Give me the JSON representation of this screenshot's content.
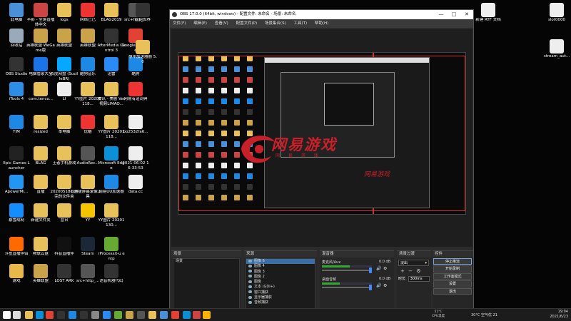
{
  "desktop_icons": [
    {
      "label": "此电脑",
      "color": "#4a90d9"
    },
    {
      "label": "回收站",
      "color": "#9ab"
    },
    {
      "label": "OBS Studio",
      "color": "#333"
    },
    {
      "label": "iTools 4",
      "color": "#2c8ee6"
    },
    {
      "label": "TIM",
      "color": "#1e88e5"
    },
    {
      "label": "Epic Games Launcher",
      "color": "#222"
    },
    {
      "label": "ApowerMi...",
      "color": "#2196f3"
    },
    {
      "label": "暴雪战网",
      "color": "#148eff"
    },
    {
      "label": "斗鱼直播伴侣",
      "color": "#ff6a00"
    },
    {
      "label": "游戏",
      "color": "#e8b84a"
    },
    {
      "label": "半影 - 全境直播体中文",
      "color": "#c44"
    },
    {
      "label": "英雄联盟 WeGame版",
      "color": "#c9a24a"
    },
    {
      "label": "电脑管家大全",
      "color": "#1a73e8"
    },
    {
      "label": "com.tenco...",
      "color": "#e8c15a"
    },
    {
      "label": "resized",
      "color": "#e8c15a"
    },
    {
      "label": "BLAG",
      "color": "#e8c15a"
    },
    {
      "label": "直播",
      "color": "#e8c15a"
    },
    {
      "label": "新建文件夹",
      "color": "#e8c15a"
    },
    {
      "label": "物联云盘",
      "color": "#e8c15a"
    },
    {
      "label": "英雄联盟",
      "color": "#c9a24a"
    },
    {
      "label": "logs",
      "color": "#e8c15a"
    },
    {
      "label": "英雄联盟",
      "color": "#c9a24a"
    },
    {
      "label": "百度网盘 (SucilleBR)",
      "color": "#06a7ff"
    },
    {
      "label": "LI",
      "color": "#eee"
    },
    {
      "label": "本电脑",
      "color": "#e8c15a"
    },
    {
      "label": "王者手机游戏",
      "color": "#e8c15a"
    },
    {
      "label": "20200518截屏完的文件夹",
      "color": "#e8c15a"
    },
    {
      "label": "营日",
      "color": "#e8c15a"
    },
    {
      "label": "抖音直播伴",
      "color": "#111"
    },
    {
      "label": "LOST ARK",
      "color": "#333"
    },
    {
      "label": "网络已已",
      "color": "#e33"
    },
    {
      "label": "英雄联盟",
      "color": "#c9a24a"
    },
    {
      "label": "酷狗音乐",
      "color": "#1e88e5"
    },
    {
      "label": "YY图片 20201118...",
      "color": "#e8c15a"
    },
    {
      "label": "优酷",
      "color": "#e33"
    },
    {
      "label": "AudioRec...",
      "color": "#555"
    },
    {
      "label": "迅捷屏幕录像工具",
      "color": "#e8c15a"
    },
    {
      "label": "YY",
      "color": "#f5c400"
    },
    {
      "label": "Steam",
      "color": "#1b2838"
    },
    {
      "label": "src+http_...",
      "color": "#555"
    },
    {
      "label": "BLAG2019",
      "color": "#e8c15a"
    },
    {
      "label": "AfterMedia Control 3",
      "color": "#333"
    },
    {
      "label": "迅雷",
      "color": "#2a8af6"
    },
    {
      "label": "腾讯 - 美剧 Ver 视频LIMAO...",
      "color": "#e8c15a"
    },
    {
      "label": "YY图片 20201118...",
      "color": "#e8c15a"
    },
    {
      "label": "Microsoft Edge",
      "color": "#0b8fd6"
    },
    {
      "label": "网易UU加速器",
      "color": "#1e88e5"
    },
    {
      "label": "YY图片 20201130...",
      "color": "#e8c15a"
    },
    {
      "label": "rProcessX-u entp",
      "color": "#6a3"
    },
    {
      "label": "语音机器代码",
      "color": "#333"
    },
    {
      "label": "src+http_...",
      "color": "#555"
    },
    {
      "label": "Google Chrome",
      "color": "#e34133"
    },
    {
      "label": "酷狗",
      "color": "#1e88e5"
    },
    {
      "label": "网易有道词典",
      "color": "#e33"
    },
    {
      "label": "bo2532fa6...",
      "color": "#eee"
    },
    {
      "label": "2021-06-02 16-33-53",
      "color": "#eee"
    },
    {
      "label": "data.cc",
      "color": "#eee"
    },
    {
      "label": "应用世界",
      "color": "#333"
    },
    {
      "label": "静中加速器器 5.0",
      "color": "#e8c15a"
    },
    {
      "label": "新建 RTF 文档",
      "color": "#eee"
    },
    {
      "label": "slot0000",
      "color": "#eee"
    },
    {
      "label": "stream_aut...",
      "color": "#eee"
    }
  ],
  "obs": {
    "title": "OBS 17.0.0 (64bit, windows) - 配置文件: 未命名 - 场景: 未命名",
    "minimize": "—",
    "maximize": "□",
    "close": "✕",
    "menu": [
      "文件(F)",
      "编辑(E)",
      "查看(V)",
      "配置文件(P)",
      "场景集合(S)",
      "工具(T)",
      "帮助(H)"
    ],
    "preview": {
      "logo_text": "网易游戏",
      "logo_sub": "网 易 游 戏",
      "logo_small": "网易游戏"
    },
    "scenes": {
      "title": "场景",
      "items": [
        "场景"
      ],
      "foot": [
        "+",
        "−",
        "∧",
        "∨"
      ]
    },
    "sources": {
      "title": "来源",
      "items": [
        "图像 6",
        "图像 4",
        "图像 3",
        "图像 2",
        "图像",
        "文本 (GDI+)",
        "窗口捕获",
        "显示器捕获",
        "音频捕获"
      ],
      "foot": [
        "+",
        "−",
        "⚙",
        "∧",
        "∨"
      ]
    },
    "mixer": {
      "title": "混音器",
      "channels": [
        {
          "name": "麦克风/Aux",
          "db": "0.0 dB",
          "level": 0.55
        },
        {
          "name": "桌面音频",
          "db": "0.0 dB",
          "level": 0.35
        }
      ]
    },
    "transitions": {
      "title": "场景过渡",
      "selected": "淡出",
      "duration_label": "时长",
      "duration_value": "300ms",
      "add": "+",
      "remove": "−",
      "settings": "⚙"
    },
    "controls": {
      "title": "控件",
      "buttons": [
        "停止推流",
        "开始录制",
        "工作室模式",
        "设置",
        "退出"
      ]
    }
  },
  "taskbar": {
    "temp": "51°C",
    "cpu": "CPU温度",
    "weather": "30°C 空气优 21",
    "time": "19:04",
    "date": "2021/6/23",
    "icons": [
      "start-icon",
      "search-icon",
      "folder-icon",
      "edge-icon",
      "chrome-icon",
      "obs-icon"
    ],
    "icon_colors": [
      "#fff",
      "#ddd",
      "#e8c15a",
      "#0b8fd6",
      "#e34133",
      "#333"
    ]
  }
}
